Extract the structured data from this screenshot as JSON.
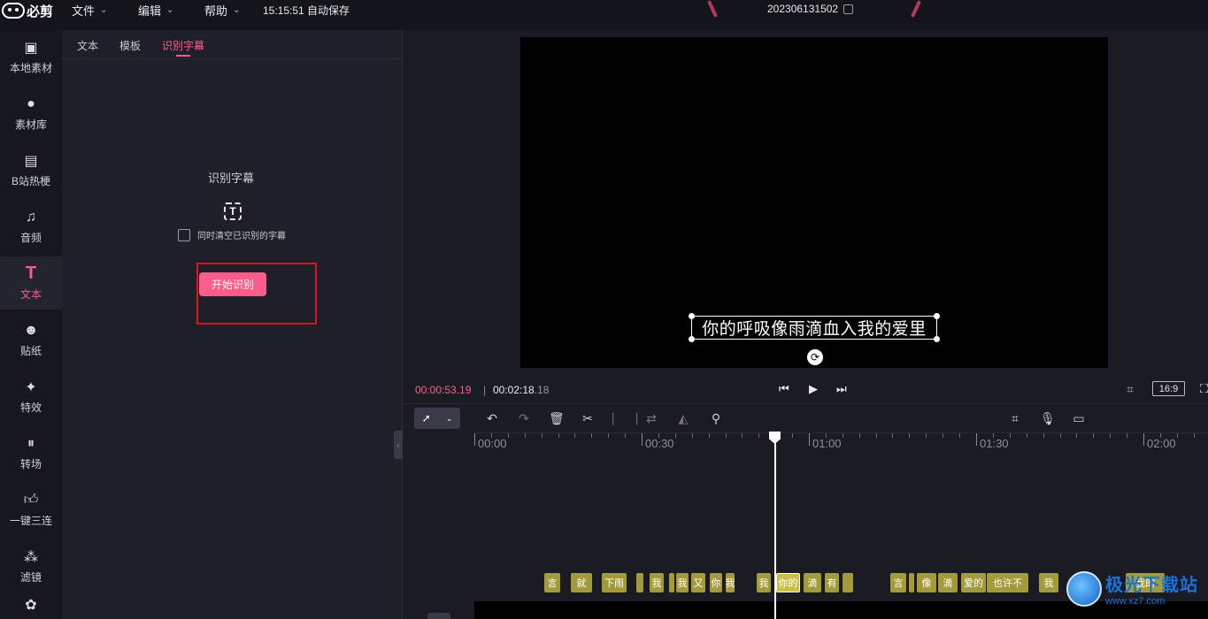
{
  "app": {
    "logo_text": "必剪",
    "menus": [
      {
        "label": "文件"
      },
      {
        "label": "编辑"
      },
      {
        "label": "帮助"
      }
    ],
    "autosave": "15:15:51 自动保存",
    "project_name": "202306131502"
  },
  "sidebar": {
    "items": [
      {
        "label": "本地素材",
        "icon": "upload-folder-icon"
      },
      {
        "label": "素材库",
        "icon": "material-library-icon"
      },
      {
        "label": "B站热梗",
        "icon": "bilibili-tv-icon"
      },
      {
        "label": "音频",
        "icon": "music-note-icon"
      },
      {
        "label": "文本",
        "icon": "text-t-icon",
        "active": true
      },
      {
        "label": "贴纸",
        "icon": "sticker-icon"
      },
      {
        "label": "特效",
        "icon": "effects-star-icon"
      },
      {
        "label": "转场",
        "icon": "transition-icon"
      },
      {
        "label": "一键三连",
        "icon": "thumbs-up-icon"
      },
      {
        "label": "滤镜",
        "icon": "filter-icon"
      }
    ]
  },
  "panel": {
    "tabs": [
      {
        "label": "文本"
      },
      {
        "label": "模板"
      },
      {
        "label": "识别字幕",
        "active": true
      }
    ],
    "title": "识别字幕",
    "checkbox_label": "同时清空已识别的字幕",
    "start_button": "开始识别"
  },
  "preview": {
    "subtitle_text": "你的呼吸像雨滴血入我的爱里",
    "current_time": "00:00:53.19",
    "total_time_main": "00:02:18",
    "total_time_frac": ".18",
    "aspect_ratio": "16:9"
  },
  "timeline": {
    "ruler_labels": [
      "00:00",
      "00:30",
      "01:00",
      "01:30",
      "02:00"
    ],
    "clips": [
      {
        "text": "言"
      },
      {
        "text": "就"
      },
      {
        "text": "下雨"
      },
      {
        "text": ""
      },
      {
        "text": "我"
      },
      {
        "text": ""
      },
      {
        "text": "我"
      },
      {
        "text": "又"
      },
      {
        "text": "你"
      },
      {
        "text": "我"
      },
      {
        "text": "你的"
      },
      {
        "text": "滴"
      },
      {
        "text": "有"
      },
      {
        "text": ""
      },
      {
        "text": "言"
      },
      {
        "text": ""
      },
      {
        "text": "像"
      },
      {
        "text": "滴"
      },
      {
        "text": "爱的"
      },
      {
        "text": "也许不"
      },
      {
        "text": "我"
      },
      {
        "text": "我的"
      }
    ]
  },
  "watermark": {
    "cn": "极光下载站",
    "url": "www.xz7.com"
  },
  "colors": {
    "accent": "#fe5c8a",
    "clip": "#a39a3a",
    "highlight": "#e0101c"
  }
}
